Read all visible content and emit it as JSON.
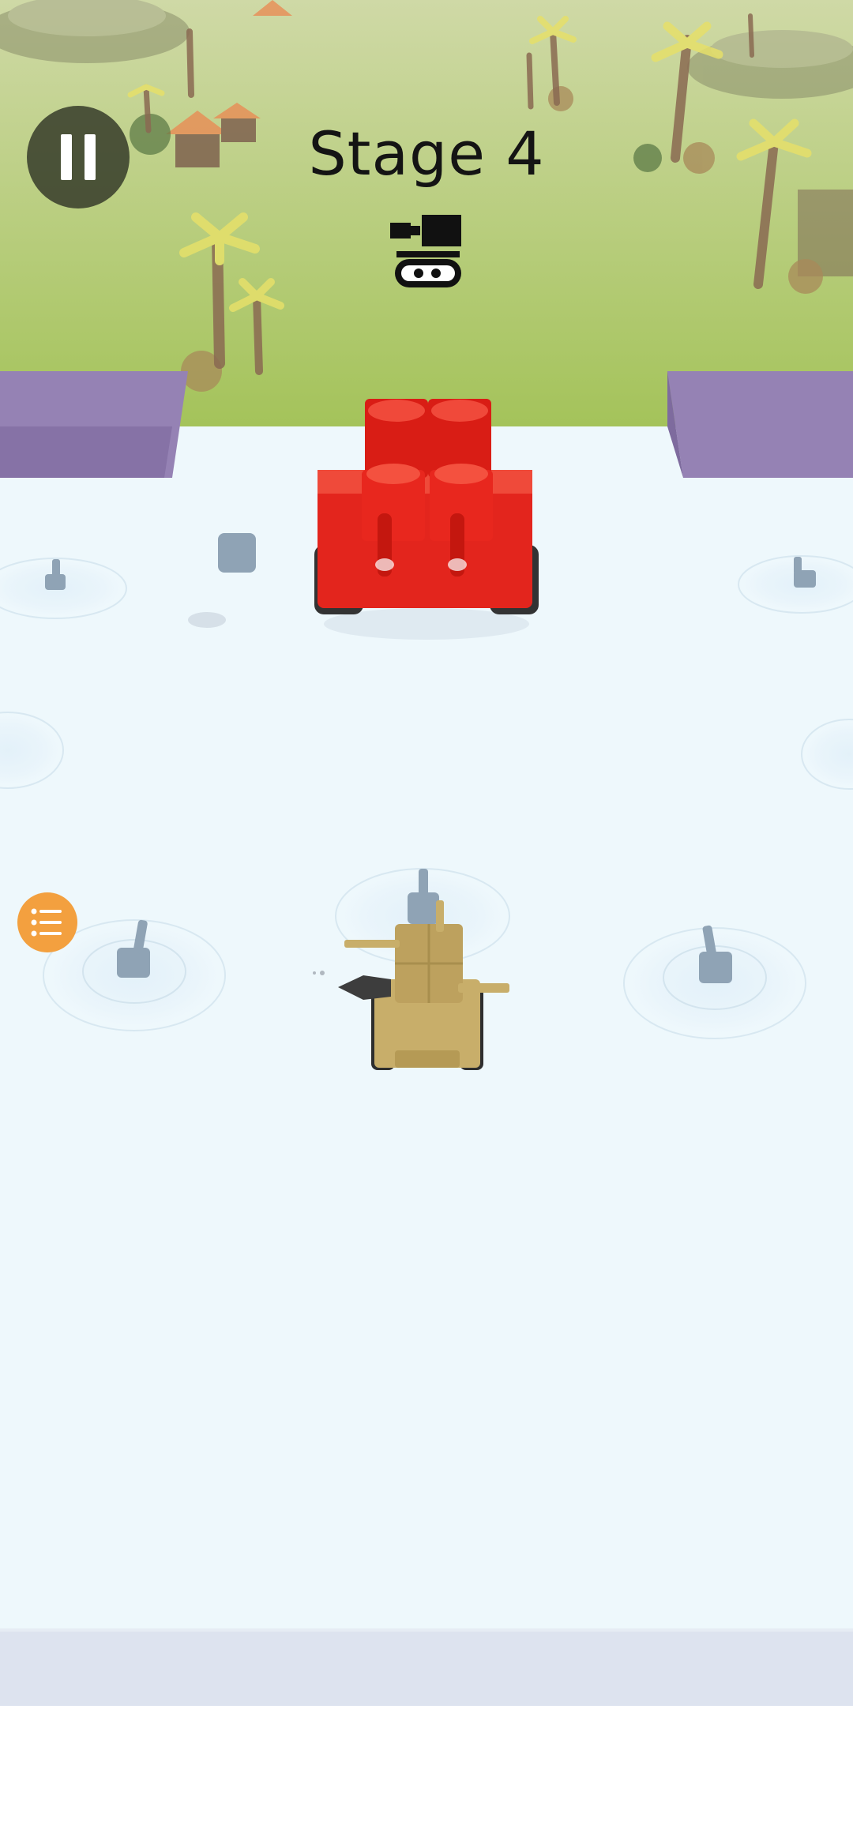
{
  "hud": {
    "stage_title": "Stage 4",
    "pause_icon": "pause-icon",
    "boss_icon": "tank-silhouette-icon",
    "menu_icon": "list-menu-icon"
  },
  "colors": {
    "grass": "#a8c25e",
    "arena_floor": "#eef7fb",
    "walls": "#8f7cae",
    "enemy_tank": "#e3251d",
    "player_tank": "#c8ae6a",
    "turrets": "#8fa3b5",
    "menu_button": "#f3a03f"
  },
  "entities": {
    "enemy_tank": "red-block-tank",
    "player_tank": "tan-block-tank",
    "turret_count": 7
  }
}
